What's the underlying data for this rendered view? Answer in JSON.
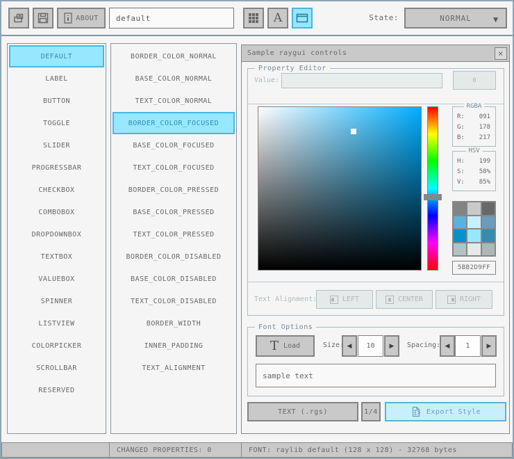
{
  "toolbar": {
    "style_name": "default",
    "about_label": "ABOUT",
    "state_label": "State:",
    "state_value": "NORMAL"
  },
  "icons": {
    "caret_down": "▼",
    "close": "×",
    "spin_left": "◀",
    "spin_right": "▶",
    "font_atlas_glyph": "A",
    "load_t_glyph": "T"
  },
  "lists": {
    "controls": [
      "DEFAULT",
      "LABEL",
      "BUTTON",
      "TOGGLE",
      "SLIDER",
      "PROGRESSBAR",
      "CHECKBOX",
      "COMBOBOX",
      "DROPDOWNBOX",
      "TEXTBOX",
      "VALUEBOX",
      "SPINNER",
      "LISTVIEW",
      "COLORPICKER",
      "SCROLLBAR",
      "RESERVED"
    ],
    "controls_selected": "DEFAULT",
    "properties": [
      "BORDER_COLOR_NORMAL",
      "BASE_COLOR_NORMAL",
      "TEXT_COLOR_NORMAL",
      "BORDER_COLOR_FOCUSED",
      "BASE_COLOR_FOCUSED",
      "TEXT_COLOR_FOCUSED",
      "BORDER_COLOR_PRESSED",
      "BASE_COLOR_PRESSED",
      "TEXT_COLOR_PRESSED",
      "BORDER_COLOR_DISABLED",
      "BASE_COLOR_DISABLED",
      "TEXT_COLOR_DISABLED",
      "BORDER_WIDTH",
      "INNER_PADDING",
      "TEXT_ALIGNMENT"
    ],
    "properties_selected": "BORDER_COLOR_FOCUSED"
  },
  "sample_window": {
    "title": "Sample raygui controls",
    "property_editor": {
      "label": "Property Editor",
      "value_label": "Value:",
      "value_text": "",
      "value_button_label": "0",
      "rgba": {
        "label": "RGBA",
        "rows": [
          [
            "R:",
            "091"
          ],
          [
            "G:",
            "178"
          ],
          [
            "B:",
            "217"
          ]
        ]
      },
      "hsv": {
        "label": "HSV",
        "rows": [
          [
            "H:",
            "199"
          ],
          [
            "S:",
            "58%"
          ],
          [
            "V:",
            "85%"
          ]
        ]
      },
      "picker": {
        "hue": 199,
        "saturation": "58%",
        "value": "85%",
        "selected_color": "#5bb2d9"
      },
      "palette": [
        "#838383",
        "#c9c9c9",
        "#686868",
        "#5bb2d9",
        "#c9effe",
        "#6c9bbc",
        "#0492c7",
        "#97e8ff",
        "#368baf",
        "#b5c1c2",
        "#e6e9e9",
        "#aeb7b7"
      ],
      "hex_value": "5BB2D9FF",
      "text_alignment_label": "Text Alignment:",
      "alignment_buttons": [
        "LEFT",
        "CENTER",
        "RIGHT"
      ]
    },
    "font_options": {
      "label": "Font Options",
      "load_label": "Load",
      "size_label": "Size:",
      "size_value": "10",
      "spacing_label": "Spacing:",
      "spacing_value": "1",
      "sample_text": "sample text"
    },
    "footer": {
      "text_format_button": "TEXT (.rgs)",
      "pager": "1/4",
      "export_button": "Export Style"
    }
  },
  "statusbar": {
    "changed_properties": "CHANGED PROPERTIES: 0",
    "font_info": "FONT: raylib default (128 x 128) - 32768 bytes"
  },
  "colors": {
    "accent_border": "#5bb2d9",
    "accent_fill": "#97e8ff",
    "accent_text": "#368baf",
    "hue_pure": "#00aeff",
    "panel_bg": "#f5f5f5",
    "chrome_bg": "#c9c9c9",
    "text_main": "#686868",
    "text_disabled": "#aeb7b7"
  }
}
